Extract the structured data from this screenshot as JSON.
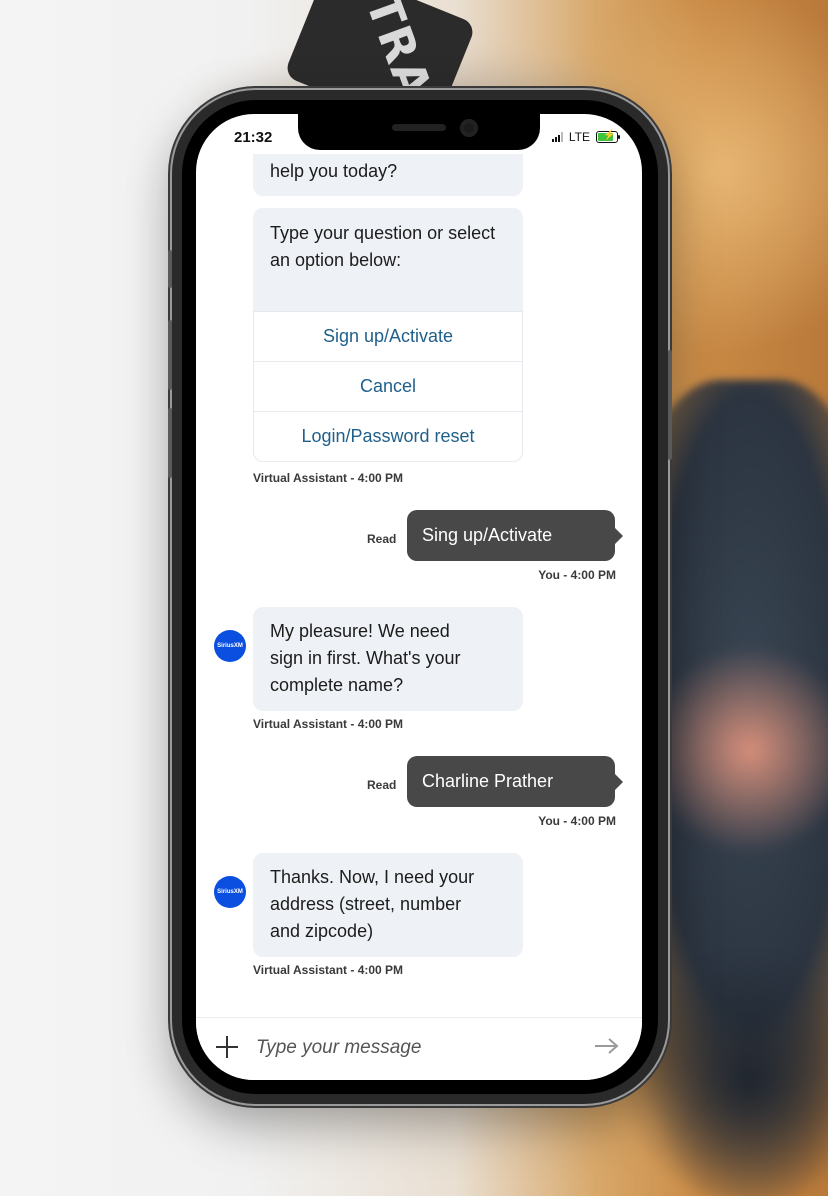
{
  "status_bar": {
    "time": "21:32",
    "network": "LTE"
  },
  "chat": {
    "bot_partial_text": "help you today?",
    "bot_prompt": "Type your question or select an option below:",
    "options": [
      "Sign up/Activate",
      "Cancel",
      "Login/Password reset"
    ],
    "bot_meta_1": "Virtual Assistant - 4:00 PM",
    "user_msg_1": "Sing up/Activate",
    "read_label_1": "Read",
    "user_meta_1": "You - 4:00 PM",
    "avatar_label": "SiriusXM",
    "bot_msg_2": "My pleasure! We need sign in first. What's your complete name?",
    "bot_meta_2": "Virtual Assistant - 4:00 PM",
    "user_msg_2": "Charline Prather",
    "read_label_2": "Read",
    "user_meta_2": "You - 4:00 PM",
    "bot_msg_3": "Thanks. Now, I need your address (street, number and zipcode)",
    "bot_meta_3": "Virtual Assistant - 4:00 PM"
  },
  "composer": {
    "placeholder": "Type your message"
  },
  "background": {
    "strap_text": "TRA"
  },
  "colors": {
    "bot_bubble": "#eef1f5",
    "user_bubble": "#484848",
    "option_link": "#1f5f8b",
    "avatar": "#0a4fe0"
  }
}
